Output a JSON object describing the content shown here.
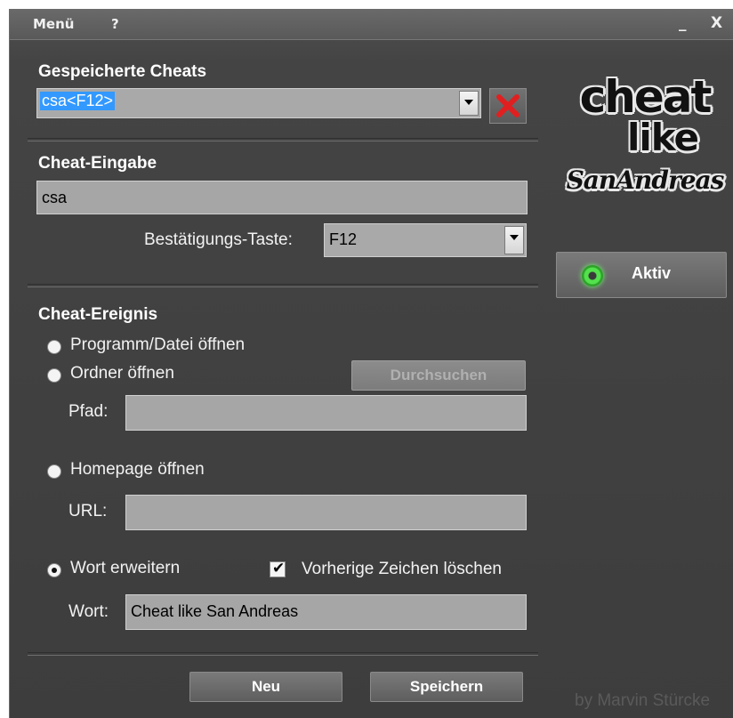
{
  "menu": {
    "menu_label": "Menü",
    "help_label": "?",
    "minimize_label": "_",
    "close_label": "X"
  },
  "saved": {
    "heading": "Gespeicherte Cheats",
    "selected": "csa<F12>"
  },
  "input": {
    "heading": "Cheat-Eingabe",
    "value": "csa",
    "confirm_label": "Bestätigungs-Taste:",
    "confirm_key": "F12"
  },
  "event": {
    "heading": "Cheat-Ereignis",
    "opt_program": "Programm/Datei öffnen",
    "opt_folder": "Ordner öffnen",
    "browse_label": "Durchsuchen",
    "path_label": "Pfad:",
    "path_value": "",
    "opt_homepage": "Homepage öffnen",
    "url_label": "URL:",
    "url_value": "",
    "opt_word": "Wort erweitern",
    "delete_prev_label": "Vorherige Zeichen löschen",
    "word_label": "Wort:",
    "word_value": "Cheat like San Andreas",
    "selected_option": "Wort erweitern",
    "delete_prev_checked": true
  },
  "buttons": {
    "new_label": "Neu",
    "save_label": "Speichern"
  },
  "logo": {
    "line1": "cheat",
    "line2": "like",
    "line3": "SanAndreas"
  },
  "status": {
    "label": "Aktiv",
    "indicator_color": "#53e24d"
  },
  "credit": "by Marvin Stürcke",
  "colors": {
    "window_bg": "#444444",
    "field_bg": "#a6a6a6",
    "highlight": "#3399ff",
    "delete_red": "#e02020"
  }
}
